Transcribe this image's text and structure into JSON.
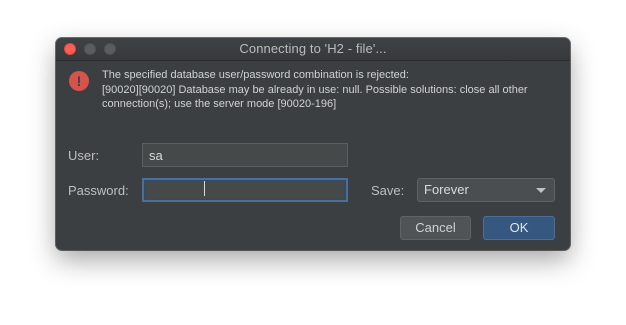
{
  "window": {
    "title": "Connecting to 'H2 - file'..."
  },
  "error": {
    "icon": "error-icon",
    "icon_glyph": "!",
    "icon_color": "#d6534c",
    "line1": "The specified database user/password combination is rejected:",
    "line2": "[90020][90020] Database may be already in use: null. Possible solutions: close all other",
    "line3": "connection(s); use the server mode [90020-196]"
  },
  "form": {
    "user_label": "User:",
    "user_value": "sa",
    "password_label": "Password:",
    "password_value": "",
    "save_label": "Save:",
    "save_selected": "Forever"
  },
  "buttons": {
    "cancel": "Cancel",
    "ok": "OK"
  },
  "colors": {
    "dialog_bg": "#3c3f41",
    "accent": "#365880",
    "focus": "#4a6f9b"
  }
}
